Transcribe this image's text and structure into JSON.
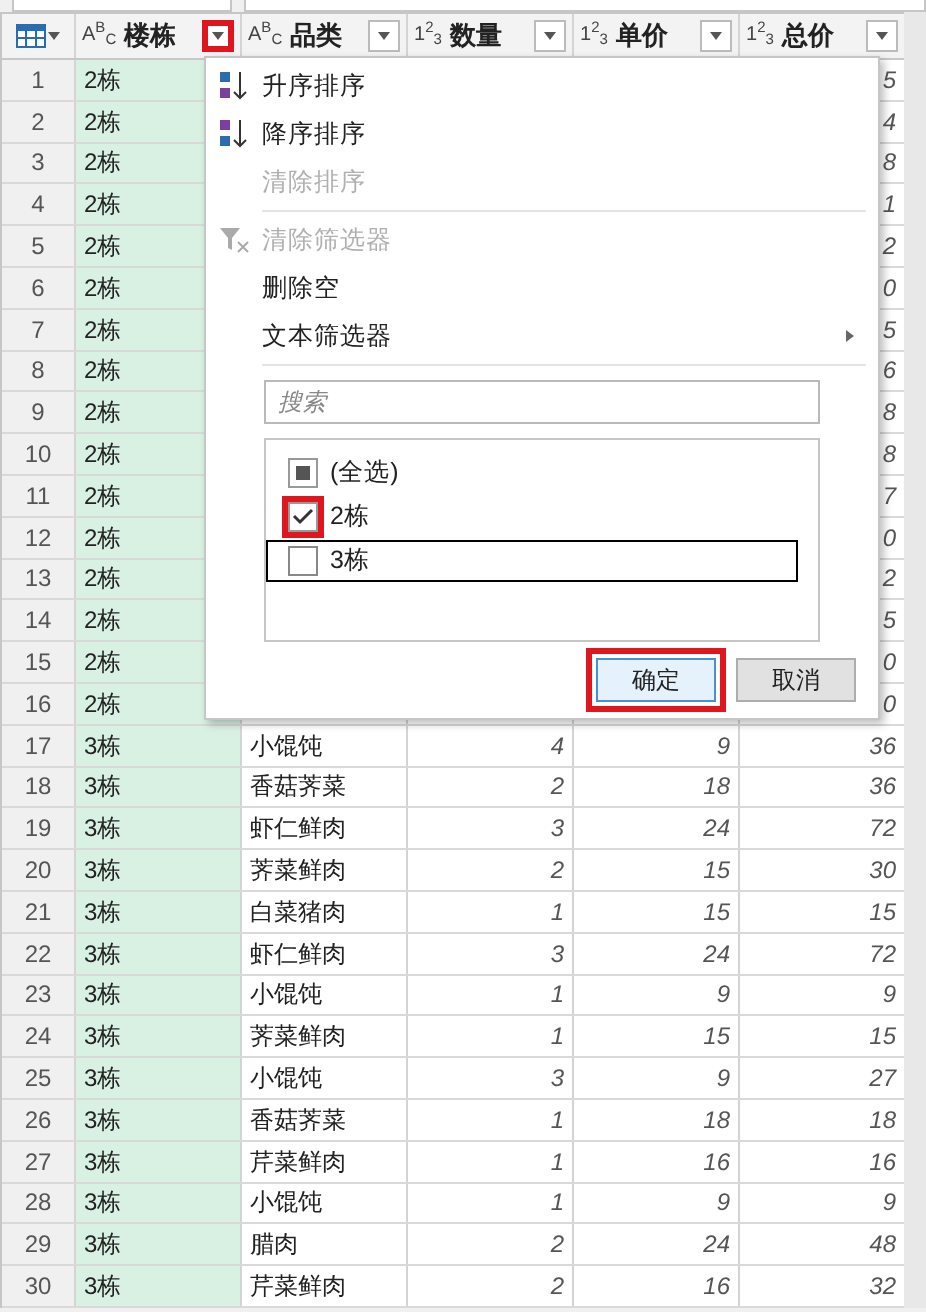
{
  "columns": [
    {
      "label": "楼栋",
      "type_label": "A$^{B}$$_{C}$",
      "kind": "text",
      "highlighted": true
    },
    {
      "label": "品类",
      "type_label": "A$^{B}$$_{C}$",
      "kind": "text",
      "highlighted": false
    },
    {
      "label": "数量",
      "type_label": "1$^{2}$$_{3}$",
      "kind": "number",
      "highlighted": false
    },
    {
      "label": "单价",
      "type_label": "1$^{2}$$_{3}$",
      "kind": "number",
      "highlighted": false
    },
    {
      "label": "总价",
      "type_label": "1$^{2}$$_{3}$",
      "kind": "number",
      "highlighted": false
    }
  ],
  "rows": [
    {
      "index": "1",
      "cells": [
        "2栋"
      ],
      "total_partial": "5"
    },
    {
      "index": "2",
      "cells": [
        "2栋"
      ],
      "total_partial": "4"
    },
    {
      "index": "3",
      "cells": [
        "2栋"
      ],
      "total_partial": "8"
    },
    {
      "index": "4",
      "cells": [
        "2栋"
      ],
      "total_partial": "1"
    },
    {
      "index": "5",
      "cells": [
        "2栋"
      ],
      "total_partial": "2"
    },
    {
      "index": "6",
      "cells": [
        "2栋"
      ],
      "total_partial": "0"
    },
    {
      "index": "7",
      "cells": [
        "2栋"
      ],
      "total_partial": "5"
    },
    {
      "index": "8",
      "cells": [
        "2栋"
      ],
      "total_partial": "6"
    },
    {
      "index": "9",
      "cells": [
        "2栋"
      ],
      "total_partial": "8"
    },
    {
      "index": "10",
      "cells": [
        "2栋"
      ],
      "total_partial": "8"
    },
    {
      "index": "11",
      "cells": [
        "2栋"
      ],
      "total_partial": "7"
    },
    {
      "index": "12",
      "cells": [
        "2栋"
      ],
      "total_partial": "0"
    },
    {
      "index": "13",
      "cells": [
        "2栋"
      ],
      "total_partial": "2"
    },
    {
      "index": "14",
      "cells": [
        "2栋"
      ],
      "total_partial": "5"
    },
    {
      "index": "15",
      "cells": [
        "2栋"
      ],
      "total_partial": "0"
    },
    {
      "index": "16",
      "cells": [
        "2栋"
      ],
      "total_partial": "0"
    },
    {
      "index": "17",
      "cells": [
        "3栋",
        "小馄饨",
        "4",
        "9",
        "36"
      ]
    },
    {
      "index": "18",
      "cells": [
        "3栋",
        "香菇荠菜",
        "2",
        "18",
        "36"
      ]
    },
    {
      "index": "19",
      "cells": [
        "3栋",
        "虾仁鲜肉",
        "3",
        "24",
        "72"
      ]
    },
    {
      "index": "20",
      "cells": [
        "3栋",
        "荠菜鲜肉",
        "2",
        "15",
        "30"
      ]
    },
    {
      "index": "21",
      "cells": [
        "3栋",
        "白菜猪肉",
        "1",
        "15",
        "15"
      ]
    },
    {
      "index": "22",
      "cells": [
        "3栋",
        "虾仁鲜肉",
        "3",
        "24",
        "72"
      ]
    },
    {
      "index": "23",
      "cells": [
        "3栋",
        "小馄饨",
        "1",
        "9",
        "9"
      ]
    },
    {
      "index": "24",
      "cells": [
        "3栋",
        "荠菜鲜肉",
        "1",
        "15",
        "15"
      ]
    },
    {
      "index": "25",
      "cells": [
        "3栋",
        "小馄饨",
        "3",
        "9",
        "27"
      ]
    },
    {
      "index": "26",
      "cells": [
        "3栋",
        "香菇荠菜",
        "1",
        "18",
        "18"
      ]
    },
    {
      "index": "27",
      "cells": [
        "3栋",
        "芹菜鲜肉",
        "1",
        "16",
        "16"
      ]
    },
    {
      "index": "28",
      "cells": [
        "3栋",
        "小馄饨",
        "1",
        "9",
        "9"
      ]
    },
    {
      "index": "29",
      "cells": [
        "3栋",
        "腊肉",
        "2",
        "24",
        "48"
      ]
    },
    {
      "index": "30",
      "cells": [
        "3栋",
        "芹菜鲜肉",
        "2",
        "16",
        "32"
      ]
    }
  ],
  "filter_menu": {
    "items": [
      {
        "label": "升序排序",
        "kind": "sort_asc",
        "disabled": false
      },
      {
        "label": "降序排序",
        "kind": "sort_desc",
        "disabled": false
      },
      {
        "label": "清除排序",
        "kind": "plain",
        "disabled": true
      },
      {
        "kind": "separator"
      },
      {
        "label": "清除筛选器",
        "kind": "clear_filter",
        "disabled": true
      },
      {
        "label": "删除空",
        "kind": "plain",
        "disabled": false
      },
      {
        "label": "文本筛选器",
        "kind": "submenu",
        "disabled": false
      },
      {
        "kind": "separator"
      }
    ],
    "search": {
      "placeholder": "搜索"
    },
    "values": [
      {
        "label": "(全选)",
        "checked": false,
        "indeterminate": true,
        "highlighted": false,
        "focused": false
      },
      {
        "label": "2栋",
        "checked": true,
        "indeterminate": false,
        "highlighted": true,
        "focused": false
      },
      {
        "label": "3栋",
        "checked": false,
        "indeterminate": false,
        "highlighted": false,
        "focused": true
      }
    ],
    "buttons": [
      {
        "label": "确定",
        "primary": true,
        "highlighted": true
      },
      {
        "label": "取消",
        "primary": false,
        "highlighted": false
      }
    ]
  }
}
